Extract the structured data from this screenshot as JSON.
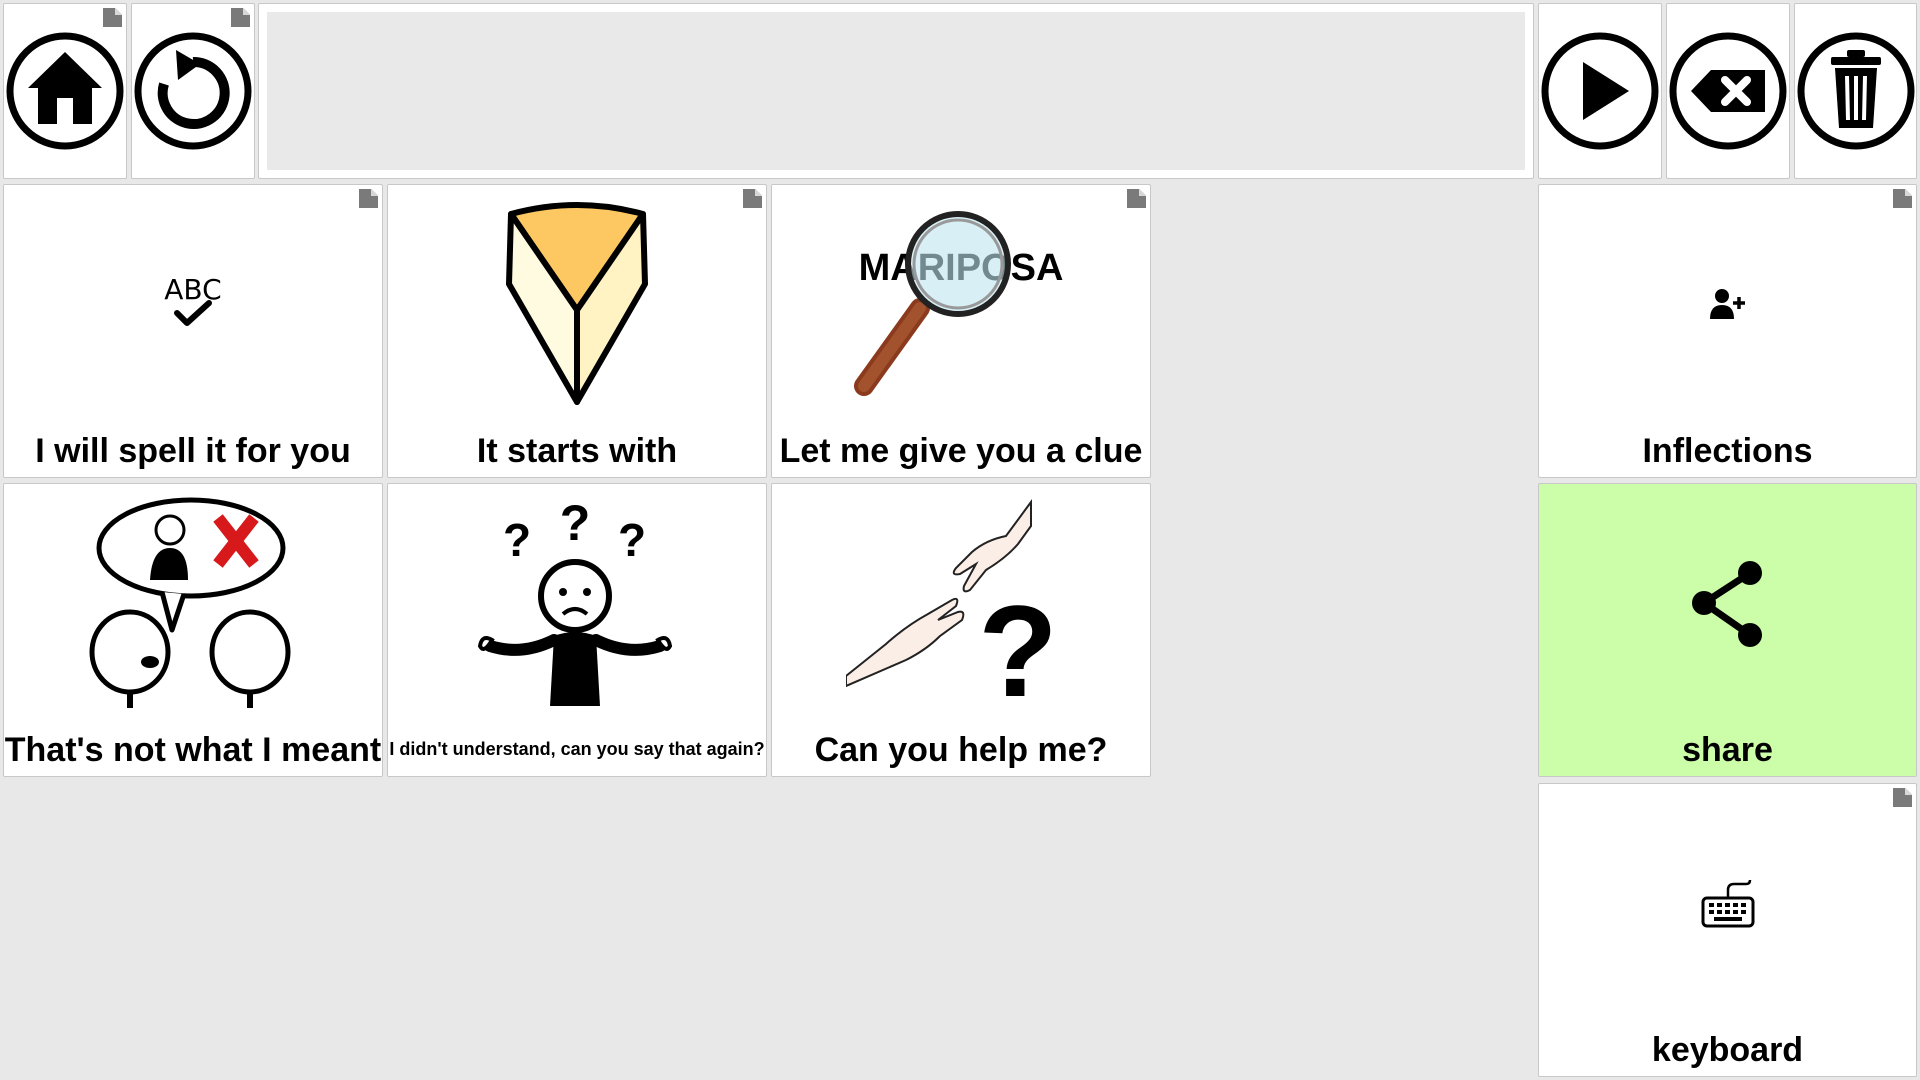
{
  "toolbar": {
    "left_buttons": [
      {
        "icon": "home-icon"
      },
      {
        "icon": "undo-icon"
      }
    ],
    "message_text": "",
    "right_buttons": [
      {
        "icon": "play-icon"
      },
      {
        "icon": "backspace-icon"
      },
      {
        "icon": "trash-icon"
      }
    ]
  },
  "grid": {
    "cells": [
      {
        "label": "I will spell it for you",
        "icon": "abc-check-icon"
      },
      {
        "label": "It starts with",
        "icon": "wedge-icon"
      },
      {
        "label": "Let me give you a clue",
        "icon": "magnifier-icon",
        "magnifier_text": "MARIPOSA"
      },
      {
        "label": "That's not what I meant",
        "icon": "not-meant-icon"
      },
      {
        "label": "I didn't understand, can you say that again?",
        "icon": "confused-person-icon"
      },
      {
        "label": "Can you help me?",
        "icon": "help-hands-icon"
      }
    ]
  },
  "sidebar": {
    "inflections": {
      "label": "Inflections",
      "icon": "add-person-icon"
    },
    "share": {
      "label": "share",
      "icon": "share-icon",
      "color": "#ccfda8"
    },
    "keyboard": {
      "label": "keyboard",
      "icon": "keyboard-icon"
    }
  }
}
